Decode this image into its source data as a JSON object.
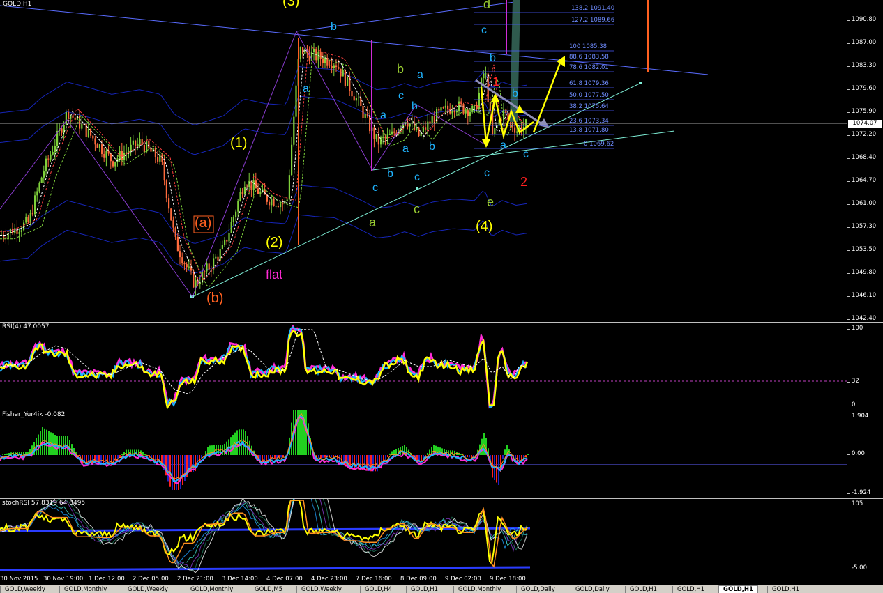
{
  "window": {
    "title": "GOLD,H1"
  },
  "main": {
    "price_ticks": [
      "1090.80",
      "1087.00",
      "1083.30",
      "1079.60",
      "1075.90",
      "1072.20",
      "1068.40",
      "1064.70",
      "1061.00",
      "1057.30",
      "1053.50",
      "1049.80",
      "1046.10",
      "1042.40"
    ],
    "current_price": "1074.07",
    "fib_levels": [
      "138.2 1091.40",
      "127.2 1089.66",
      "100 1085.38",
      "88.6 1083.58",
      "78.6 1082.01",
      "61.8 1079.36",
      "50.0 1077.50",
      "38.2 1075.64",
      "23.6 1073.34",
      "13.8 1071.80",
      "0 1069.62"
    ],
    "wave_labels": {
      "w3": "(3)",
      "w1": "(1)",
      "w2": "(2)",
      "w4": "(4)",
      "wa": "(a)",
      "wb": "(b)",
      "flat": "flat",
      "red1": "1",
      "red2": "2",
      "d": "d",
      "e": "e",
      "g_a": "a",
      "g_b": "b",
      "g_c": "c",
      "c_b_top": "b",
      "c_c_top": "c",
      "c_a_left": "a",
      "c_a_mid": "a",
      "c_c_mid": "c",
      "c_b_mid": "b",
      "c_a_low": "a",
      "c_b_low": "b",
      "c_c_low1": "c",
      "c_b_low2": "b",
      "c_c_low2": "c",
      "c_b_r1": "b",
      "c_a_r": "a",
      "c_b_r": "b",
      "c_c_r": "c",
      "c_c_r2": "c",
      "c_a_r2": "a"
    }
  },
  "rsi": {
    "title": "RSI(4) 47.0057",
    "ticks": [
      "100",
      "32",
      "0"
    ]
  },
  "fisher": {
    "title": "Fisher_Yur4ik -0.082",
    "ticks": [
      "1.904",
      "0.00",
      "-1.924"
    ]
  },
  "stoch": {
    "title": "stochRSI 57.8319 64.8495",
    "ticks": [
      "105",
      "-5.00"
    ]
  },
  "time_labels": [
    "30 Nov 2015",
    "30 Nov 19:00",
    "1 Dec 12:00",
    "2 Dec 05:00",
    "2 Dec 21:00",
    "3 Dec 14:00",
    "4 Dec 07:00",
    "4 Dec 23:00",
    "7 Dec 16:00",
    "8 Dec 09:00",
    "9 Dec 02:00",
    "9 Dec 18:00"
  ],
  "tabs": [
    "GOLD,Weekly",
    "GOLD,Monthly",
    "GOLD,Weekly",
    "GOLD,Monthly",
    "GOLD,M5",
    "GOLD,Weekly",
    "GOLD,H4",
    "GOLD,H1",
    "GOLD,Monthly",
    "GOLD,Daily",
    "GOLD,Daily",
    "GOLD,H1",
    "GOLD,H1",
    "GOLD,H1",
    "GOLD,H1"
  ],
  "colors": {
    "bull": "#7fd13b",
    "bear": "#ff6b3d",
    "yellow": "#ffff00",
    "cyan": "#1fb4ff",
    "olive": "#9acd32",
    "red": "#ff2020",
    "orange": "#ff6020",
    "magenta": "#ff2bd6",
    "blue": "#2a3cff"
  }
}
